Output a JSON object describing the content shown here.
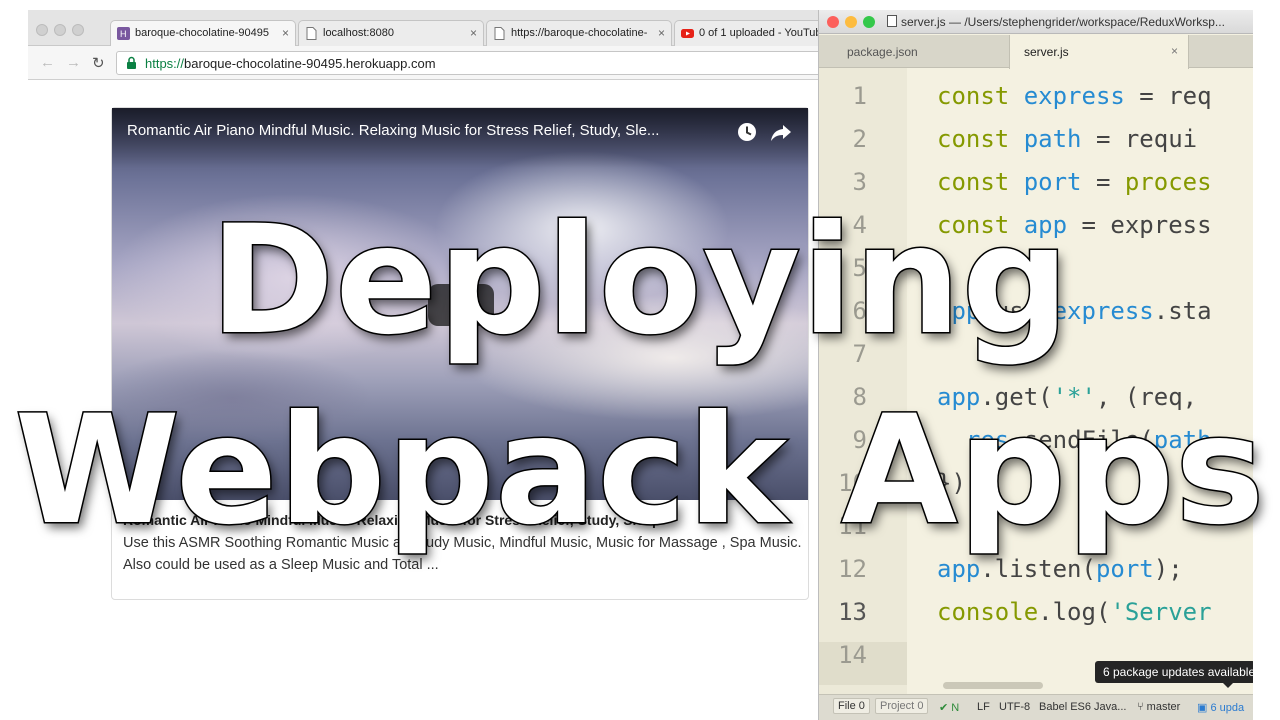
{
  "browser": {
    "tabs": [
      {
        "label": "baroque-chocolatine-90495",
        "icon": "heroku-icon",
        "active": true
      },
      {
        "label": "localhost:8080",
        "icon": "page-icon",
        "active": false
      },
      {
        "label": "https://baroque-chocolatine-",
        "icon": "page-icon",
        "active": false
      },
      {
        "label": "0 of 1 uploaded - YouTube",
        "icon": "youtube-icon",
        "active": false
      }
    ],
    "close_glyph": "×",
    "back_glyph": "←",
    "forward_glyph": "→",
    "reload_glyph": "↻",
    "url_scheme": "https://",
    "url_host": "baroque-chocolatine-90495.herokuapp.com"
  },
  "page": {
    "video_title": "Romantic Air Piano Mindful Music. Relaxing Music for Stress Relief, Study, Sle...",
    "card_title": "Romantic Air Piano Mindful Music. Relaxing Music for Stress Relief, Study, Sleep",
    "card_description": "Use this ASMR Soothing Romantic Music as Study Music, Mindful Music, Music for Massage , Spa Music. Also could be used as a Sleep Music and Total ..."
  },
  "editor": {
    "window_title": "server.js — /Users/stephengrider/workspace/ReduxWorksp...",
    "tabs": [
      {
        "label": "package.json",
        "active": false
      },
      {
        "label": "server.js",
        "active": true
      }
    ],
    "line_numbers": [
      "1",
      "2",
      "3",
      "4",
      "5",
      "6",
      "7",
      "8",
      "9",
      "10",
      "11",
      "12",
      "13",
      "14"
    ],
    "code": {
      "l1": {
        "kw": "const",
        "var": "express",
        "rest": " = req"
      },
      "l2": {
        "kw": "const",
        "var": "path",
        "rest": " = requi"
      },
      "l3": {
        "kw": "const",
        "var": "port",
        "rest": " = ",
        "kw2": "proces"
      },
      "l4": {
        "kw": "const",
        "var": "app",
        "rest": " = express"
      },
      "l6": {
        "obj": "app",
        "rest": ".use(",
        "var": "express",
        "rest2": ".sta"
      },
      "l8": {
        "obj": "app",
        "rest": ".get(",
        "str": "'*'",
        "rest2": ", (req,"
      },
      "l9": {
        "indent": "  ",
        "obj": "res",
        "rest": ".sendFile(",
        "var": "path"
      },
      "l10": {
        "text": "});"
      },
      "l12": {
        "obj": "app",
        "rest": ".listen(",
        "var": "port",
        "rest2": ");"
      },
      "l13": {
        "obj": "console",
        "rest": ".log(",
        "str": "'Server"
      }
    },
    "tooltip": "6 package updates available",
    "status": {
      "file_label": "File",
      "file_count": "0",
      "project_label": "Project",
      "project_count": "0",
      "check": "✔ N",
      "line_ending": "LF",
      "encoding": "UTF-8",
      "grammar": "Babel ES6 Java...",
      "branch": "master",
      "updates": "6 upda"
    },
    "colors": {
      "keyword": "#859900",
      "variable": "#268bd2",
      "string": "#2aa198",
      "background": "#f4f1e1"
    }
  },
  "overlay": {
    "line1": "Deploying",
    "line2": "Webpack Apps"
  }
}
